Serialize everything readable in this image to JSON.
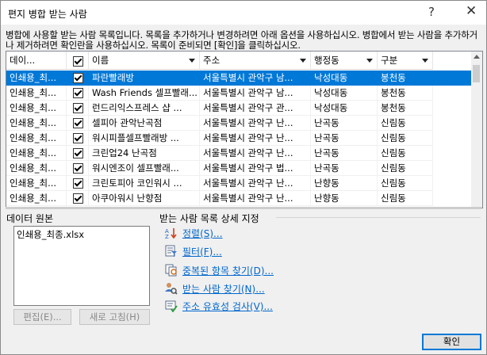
{
  "window": {
    "title": "편지 병합 받는 사람",
    "help": "?",
    "close": "✕"
  },
  "description": "병합에 사용할 받는 사람 목록입니다. 목록을 추가하거나 변경하려면 아래 옵션을 사용하십시오. 병합에서 받는 사람을 추가하거나 제거하려면 확인란을 사용하십시오. 목록이 준비되면 [확인]을 클릭하십시오.",
  "columns": [
    {
      "label": "데이...",
      "arrow": false
    },
    {
      "label": "",
      "arrow": false,
      "checkbox": true
    },
    {
      "label": "이름",
      "arrow": true
    },
    {
      "label": "주소",
      "arrow": true
    },
    {
      "label": "행정동",
      "arrow": true
    },
    {
      "label": "구분",
      "arrow": true
    }
  ],
  "rows": [
    {
      "source": "인쇄용_최...",
      "checked": true,
      "name": "파란빨래방",
      "address": "서울특별시 관악구 남...",
      "dong": "낙성대동",
      "type": "봉천동",
      "selected": true
    },
    {
      "source": "인쇄용_최...",
      "checked": true,
      "name": "Wash Friends 셀프빨래...",
      "address": "서울특별시 관악구 남...",
      "dong": "낙성대동",
      "type": "봉천동",
      "selected": false
    },
    {
      "source": "인쇄용_최...",
      "checked": true,
      "name": "런드리익스프레스 샵 ...",
      "address": "서울특별시 관악구 관...",
      "dong": "낙성대동",
      "type": "봉천동",
      "selected": false
    },
    {
      "source": "인쇄용_최...",
      "checked": true,
      "name": "셀피아 관악난곡점",
      "address": "서울특별시 관악구 난...",
      "dong": "난곡동",
      "type": "신림동",
      "selected": false
    },
    {
      "source": "인쇄용_최...",
      "checked": true,
      "name": "워시피플셀프빨래방 ...",
      "address": "서울특별시 관악구 난...",
      "dong": "난곡동",
      "type": "신림동",
      "selected": false
    },
    {
      "source": "인쇄용_최...",
      "checked": true,
      "name": "크린업24 난곡점",
      "address": "서울특별시 관악구 난...",
      "dong": "난곡동",
      "type": "신림동",
      "selected": false
    },
    {
      "source": "인쇄용_최...",
      "checked": true,
      "name": "워시엔조이 셀프빨래...",
      "address": "서울특별시 관악구 법...",
      "dong": "난곡동",
      "type": "신림동",
      "selected": false
    },
    {
      "source": "인쇄용_최...",
      "checked": true,
      "name": "크린토피아 코인워시 ...",
      "address": "서울특별시 관악구 난...",
      "dong": "난향동",
      "type": "신림동",
      "selected": false
    },
    {
      "source": "인쇄용_최...",
      "checked": true,
      "name": "아쿠아워시 난향점",
      "address": "서울특별시 관악구 난...",
      "dong": "난향동",
      "type": "신림동",
      "selected": false
    }
  ],
  "data_source": {
    "label": "데이터 원본",
    "items": [
      "인쇄용_최종.xlsx"
    ],
    "edit_button": "편집(E)...",
    "refresh_button": "새로 고침(H)"
  },
  "refine": {
    "label": "받는 사람 목록 상세 지정",
    "links": [
      {
        "label": "정렬(S)...",
        "icon": "sort-icon"
      },
      {
        "label": "필터(F)...",
        "icon": "filter-icon"
      },
      {
        "label": "중복된 항목 찾기(D)...",
        "icon": "find-duplicates-icon"
      },
      {
        "label": "받는 사람 찾기(N)...",
        "icon": "find-recipient-icon"
      },
      {
        "label": "주소 유효성 검사(V)...",
        "icon": "validate-address-icon"
      }
    ]
  },
  "ok_button": "확인",
  "colors": {
    "selection": "#0078d7",
    "link": "#0066cc"
  }
}
